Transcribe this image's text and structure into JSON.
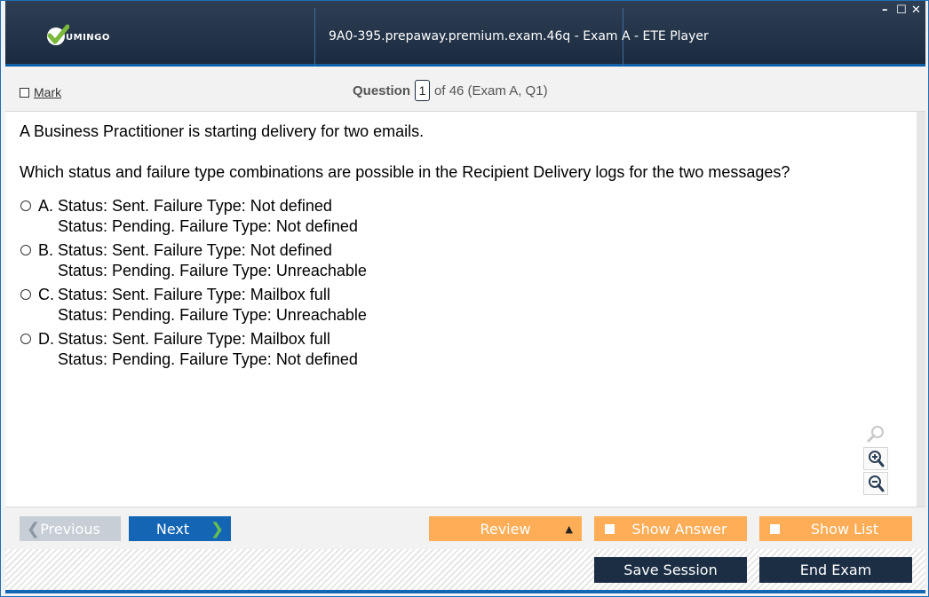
{
  "window": {
    "title": "9A0-395.prepaway.premium.exam.46q - Exam A - ETE Player",
    "logo_text": "UMINGO",
    "controls": {
      "minimize": "–",
      "maximize": "☐",
      "close": "✕"
    }
  },
  "question_bar": {
    "mark_label": "Mark",
    "question_label": "Question",
    "question_number": "1",
    "question_of": "of 46 (Exam A, Q1)"
  },
  "question": {
    "stem_line1": "A Business Practitioner is starting delivery for two emails.",
    "stem_line2": "Which status and failure type combinations are possible in the Recipient Delivery logs for the two messages?",
    "options": [
      {
        "letter": "A.",
        "line1": "Status: Sent. Failure Type: Not defined",
        "line2": "Status: Pending. Failure Type: Not defined"
      },
      {
        "letter": "B.",
        "line1": "Status: Sent. Failure Type: Not defined",
        "line2": "Status: Pending. Failure Type: Unreachable"
      },
      {
        "letter": "C.",
        "line1": "Status: Sent. Failure Type: Mailbox full",
        "line2": "Status: Pending. Failure Type: Unreachable"
      },
      {
        "letter": "D.",
        "line1": "Status: Sent. Failure Type: Mailbox full",
        "line2": "Status: Pending. Failure Type: Not defined"
      }
    ]
  },
  "zoom_tools": {
    "icons": [
      "search-icon",
      "zoom-in-icon",
      "zoom-out-icon"
    ]
  },
  "nav": {
    "previous_label": "Previous",
    "next_label": "Next",
    "review_label": "Review",
    "show_answer_label": "Show Answer",
    "show_list_label": "Show List"
  },
  "footer": {
    "save_session_label": "Save Session",
    "end_exam_label": "End Exam"
  },
  "colors": {
    "titlebar": "#1b2b3f",
    "accent_blue": "#1466b5",
    "orange": "#ffad57",
    "dark_button": "#1c2e44",
    "logo_green": "#79b83a"
  }
}
